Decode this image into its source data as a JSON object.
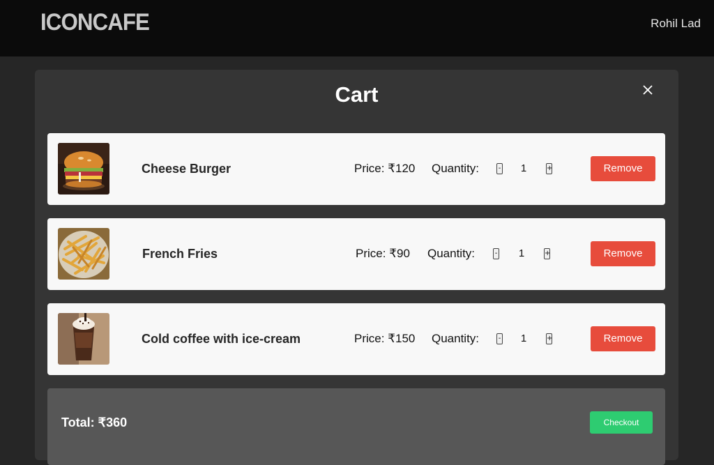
{
  "header": {
    "logo_text": "ICONCAFE",
    "user_name": "Rohil Lad"
  },
  "cart": {
    "title": "Cart",
    "price_prefix": "Price: ",
    "quantity_label": "Quantity:",
    "minus_label": "-",
    "plus_label": "+",
    "remove_label": "Remove",
    "items": [
      {
        "name": "Cheese Burger",
        "price": "Price: ₹120",
        "quantity": "1",
        "image": "burger-image"
      },
      {
        "name": "French Fries",
        "price": "Price: ₹90",
        "quantity": "1",
        "image": "fries-image"
      },
      {
        "name": "Cold coffee with ice-cream",
        "price": "Price: ₹150",
        "quantity": "1",
        "image": "coffee-image"
      }
    ],
    "total": "Total: ₹360",
    "checkout_label": "Checkout"
  },
  "colors": {
    "remove": "#e74c3c",
    "checkout": "#2ecc71",
    "topbar": "#0b0b0b",
    "modal": "#353535"
  }
}
